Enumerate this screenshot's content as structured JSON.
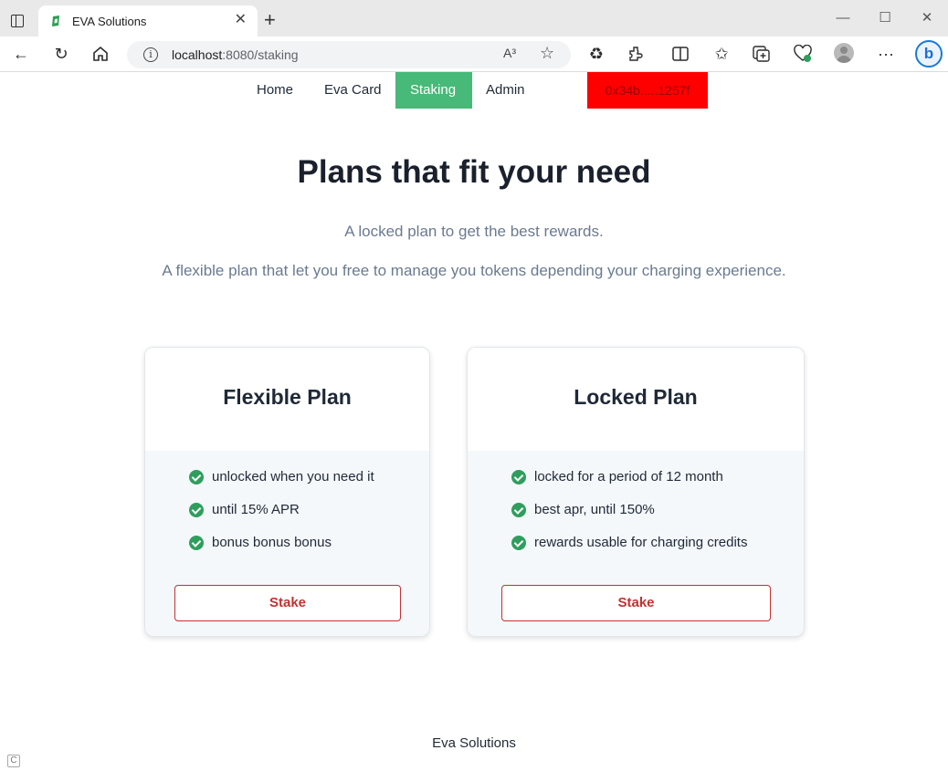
{
  "browser": {
    "tab_title": "EVA Solutions",
    "url_host": "localhost",
    "url_path": ":8080/staking",
    "read_aloud_label": "A³",
    "icons": [
      "sidebar-toggle-icon",
      "favicon-icon",
      "close-icon",
      "new-tab-icon",
      "minimize-icon",
      "maximize-icon",
      "window-close-icon",
      "back-icon",
      "refresh-icon",
      "home-icon",
      "site-info-icon",
      "read-aloud-icon",
      "favorite-star-icon",
      "recycle-extension-icon",
      "extensions-icon",
      "split-screen-icon",
      "favorites-icon",
      "collections-icon",
      "browser-essentials-icon",
      "profile-avatar-icon",
      "more-icon",
      "bing-copilot-icon"
    ]
  },
  "nav": {
    "items": [
      {
        "label": "Home"
      },
      {
        "label": "Eva Card"
      },
      {
        "label": "Staking"
      },
      {
        "label": "Admin"
      }
    ],
    "wallet": "0x34b.....1257f",
    "active_color": "#47b978",
    "wallet_color": "#ff0000"
  },
  "hero": {
    "title": "Plans that fit your need",
    "line1": "A locked plan to get the best rewards.",
    "line2": "A flexible plan that let you free to manage you tokens depending your charging experience."
  },
  "plans": [
    {
      "title": "Flexible Plan",
      "features": [
        "unlocked when you need it",
        "until 15% APR",
        "bonus bonus bonus"
      ],
      "button": "Stake"
    },
    {
      "title": "Locked Plan",
      "features": [
        "locked for a period of 12 month",
        "best apr, until 150%",
        "rewards usable for charging credits"
      ],
      "button": "Stake"
    }
  ],
  "footer": {
    "text": "Eva Solutions"
  }
}
